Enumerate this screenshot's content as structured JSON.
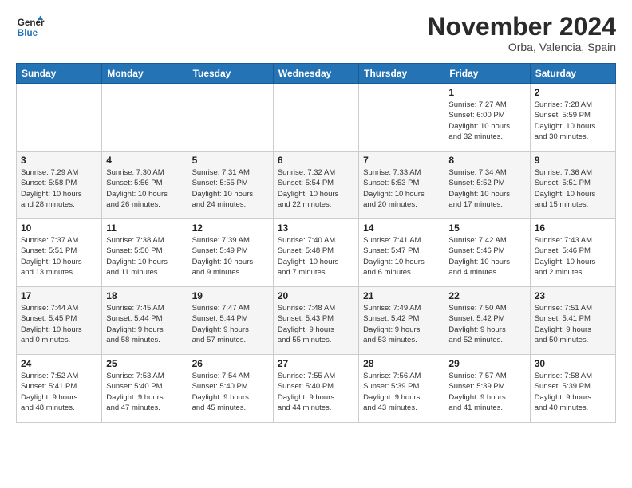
{
  "header": {
    "logo_line1": "General",
    "logo_line2": "Blue",
    "month": "November 2024",
    "location": "Orba, Valencia, Spain"
  },
  "weekdays": [
    "Sunday",
    "Monday",
    "Tuesday",
    "Wednesday",
    "Thursday",
    "Friday",
    "Saturday"
  ],
  "weeks": [
    [
      {
        "day": "",
        "info": ""
      },
      {
        "day": "",
        "info": ""
      },
      {
        "day": "",
        "info": ""
      },
      {
        "day": "",
        "info": ""
      },
      {
        "day": "",
        "info": ""
      },
      {
        "day": "1",
        "info": "Sunrise: 7:27 AM\nSunset: 6:00 PM\nDaylight: 10 hours\nand 32 minutes."
      },
      {
        "day": "2",
        "info": "Sunrise: 7:28 AM\nSunset: 5:59 PM\nDaylight: 10 hours\nand 30 minutes."
      }
    ],
    [
      {
        "day": "3",
        "info": "Sunrise: 7:29 AM\nSunset: 5:58 PM\nDaylight: 10 hours\nand 28 minutes."
      },
      {
        "day": "4",
        "info": "Sunrise: 7:30 AM\nSunset: 5:56 PM\nDaylight: 10 hours\nand 26 minutes."
      },
      {
        "day": "5",
        "info": "Sunrise: 7:31 AM\nSunset: 5:55 PM\nDaylight: 10 hours\nand 24 minutes."
      },
      {
        "day": "6",
        "info": "Sunrise: 7:32 AM\nSunset: 5:54 PM\nDaylight: 10 hours\nand 22 minutes."
      },
      {
        "day": "7",
        "info": "Sunrise: 7:33 AM\nSunset: 5:53 PM\nDaylight: 10 hours\nand 20 minutes."
      },
      {
        "day": "8",
        "info": "Sunrise: 7:34 AM\nSunset: 5:52 PM\nDaylight: 10 hours\nand 17 minutes."
      },
      {
        "day": "9",
        "info": "Sunrise: 7:36 AM\nSunset: 5:51 PM\nDaylight: 10 hours\nand 15 minutes."
      }
    ],
    [
      {
        "day": "10",
        "info": "Sunrise: 7:37 AM\nSunset: 5:51 PM\nDaylight: 10 hours\nand 13 minutes."
      },
      {
        "day": "11",
        "info": "Sunrise: 7:38 AM\nSunset: 5:50 PM\nDaylight: 10 hours\nand 11 minutes."
      },
      {
        "day": "12",
        "info": "Sunrise: 7:39 AM\nSunset: 5:49 PM\nDaylight: 10 hours\nand 9 minutes."
      },
      {
        "day": "13",
        "info": "Sunrise: 7:40 AM\nSunset: 5:48 PM\nDaylight: 10 hours\nand 7 minutes."
      },
      {
        "day": "14",
        "info": "Sunrise: 7:41 AM\nSunset: 5:47 PM\nDaylight: 10 hours\nand 6 minutes."
      },
      {
        "day": "15",
        "info": "Sunrise: 7:42 AM\nSunset: 5:46 PM\nDaylight: 10 hours\nand 4 minutes."
      },
      {
        "day": "16",
        "info": "Sunrise: 7:43 AM\nSunset: 5:46 PM\nDaylight: 10 hours\nand 2 minutes."
      }
    ],
    [
      {
        "day": "17",
        "info": "Sunrise: 7:44 AM\nSunset: 5:45 PM\nDaylight: 10 hours\nand 0 minutes."
      },
      {
        "day": "18",
        "info": "Sunrise: 7:45 AM\nSunset: 5:44 PM\nDaylight: 9 hours\nand 58 minutes."
      },
      {
        "day": "19",
        "info": "Sunrise: 7:47 AM\nSunset: 5:44 PM\nDaylight: 9 hours\nand 57 minutes."
      },
      {
        "day": "20",
        "info": "Sunrise: 7:48 AM\nSunset: 5:43 PM\nDaylight: 9 hours\nand 55 minutes."
      },
      {
        "day": "21",
        "info": "Sunrise: 7:49 AM\nSunset: 5:42 PM\nDaylight: 9 hours\nand 53 minutes."
      },
      {
        "day": "22",
        "info": "Sunrise: 7:50 AM\nSunset: 5:42 PM\nDaylight: 9 hours\nand 52 minutes."
      },
      {
        "day": "23",
        "info": "Sunrise: 7:51 AM\nSunset: 5:41 PM\nDaylight: 9 hours\nand 50 minutes."
      }
    ],
    [
      {
        "day": "24",
        "info": "Sunrise: 7:52 AM\nSunset: 5:41 PM\nDaylight: 9 hours\nand 48 minutes."
      },
      {
        "day": "25",
        "info": "Sunrise: 7:53 AM\nSunset: 5:40 PM\nDaylight: 9 hours\nand 47 minutes."
      },
      {
        "day": "26",
        "info": "Sunrise: 7:54 AM\nSunset: 5:40 PM\nDaylight: 9 hours\nand 45 minutes."
      },
      {
        "day": "27",
        "info": "Sunrise: 7:55 AM\nSunset: 5:40 PM\nDaylight: 9 hours\nand 44 minutes."
      },
      {
        "day": "28",
        "info": "Sunrise: 7:56 AM\nSunset: 5:39 PM\nDaylight: 9 hours\nand 43 minutes."
      },
      {
        "day": "29",
        "info": "Sunrise: 7:57 AM\nSunset: 5:39 PM\nDaylight: 9 hours\nand 41 minutes."
      },
      {
        "day": "30",
        "info": "Sunrise: 7:58 AM\nSunset: 5:39 PM\nDaylight: 9 hours\nand 40 minutes."
      }
    ]
  ]
}
